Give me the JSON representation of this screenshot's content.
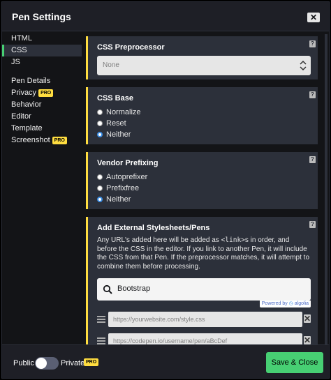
{
  "modal": {
    "title": "Pen Settings",
    "close_glyph": "✕"
  },
  "sidebar": {
    "group1": [
      {
        "label": "HTML",
        "active": false
      },
      {
        "label": "CSS",
        "active": true
      },
      {
        "label": "JS",
        "active": false
      }
    ],
    "group2": [
      {
        "label": "Pen Details",
        "pro": false
      },
      {
        "label": "Privacy",
        "pro": true
      },
      {
        "label": "Behavior",
        "pro": false
      },
      {
        "label": "Editor",
        "pro": false
      },
      {
        "label": "Template",
        "pro": false
      },
      {
        "label": "Screenshot",
        "pro": true
      }
    ],
    "pro_badge": "PRO"
  },
  "sections": {
    "preprocessor": {
      "title": "CSS Preprocessor",
      "selected": "None",
      "help": "?"
    },
    "css_base": {
      "title": "CSS Base",
      "help": "?",
      "options": [
        {
          "label": "Normalize",
          "checked": false
        },
        {
          "label": "Reset",
          "checked": false
        },
        {
          "label": "Neither",
          "checked": true
        }
      ]
    },
    "vendor_prefixing": {
      "title": "Vendor Prefixing",
      "help": "?",
      "options": [
        {
          "label": "Autoprefixer",
          "checked": false
        },
        {
          "label": "Prefixfree",
          "checked": false
        },
        {
          "label": "Neither",
          "checked": true
        }
      ]
    },
    "external": {
      "title": "Add External Stylesheets/Pens",
      "help": "?",
      "desc_before": "Any URL's added here will be added as ",
      "desc_code": "<link>",
      "desc_after": "s in order, and before the CSS in the editor. If you link to another Pen, it will include the CSS from that Pen. If the preprocessor matches, it will attempt to combine them before processing.",
      "search_value": "Bootstrap",
      "powered_by": "Powered by",
      "algolia": "algolia",
      "url_placeholders": [
        "https://yourwebsite.com/style.css",
        "https://codepen.io/username/pen/aBcDef"
      ],
      "clear_glyph": "✕"
    }
  },
  "footer": {
    "public_label": "Public",
    "private_label": "Private",
    "pro_badge": "PRO",
    "save_label": "Save & Close"
  },
  "colors": {
    "accent": "#47cf73",
    "section_border": "#ffdd40",
    "pro_badge": "#ffdd40",
    "radio_selected": "#3b8ee5"
  }
}
